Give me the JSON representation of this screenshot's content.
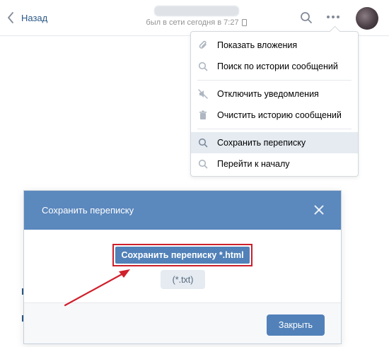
{
  "header": {
    "back_label": "Назад",
    "status_text": "был в сети сегодня в 7:27"
  },
  "menu": {
    "items": [
      {
        "label": "Показать вложения",
        "icon": "paperclip-icon"
      },
      {
        "label": "Поиск по истории сообщений",
        "icon": "search-icon"
      },
      {
        "label": "Отключить уведомления",
        "icon": "mute-icon"
      },
      {
        "label": "Очистить историю сообщений",
        "icon": "trash-icon"
      },
      {
        "label": "Сохранить переписку",
        "icon": "search-icon",
        "active": true
      },
      {
        "label": "Перейти к началу",
        "icon": "search-icon"
      }
    ]
  },
  "modal": {
    "title": "Сохранить переписку",
    "save_html_label": "Сохранить переписку *.html",
    "save_txt_label": "(*.txt)",
    "close_label": "Закрыть"
  },
  "colors": {
    "header_blue": "#5b88bd",
    "button_blue": "#5181b8",
    "highlight_red": "#cc1f2a",
    "menu_active": "#e5ebf1"
  }
}
